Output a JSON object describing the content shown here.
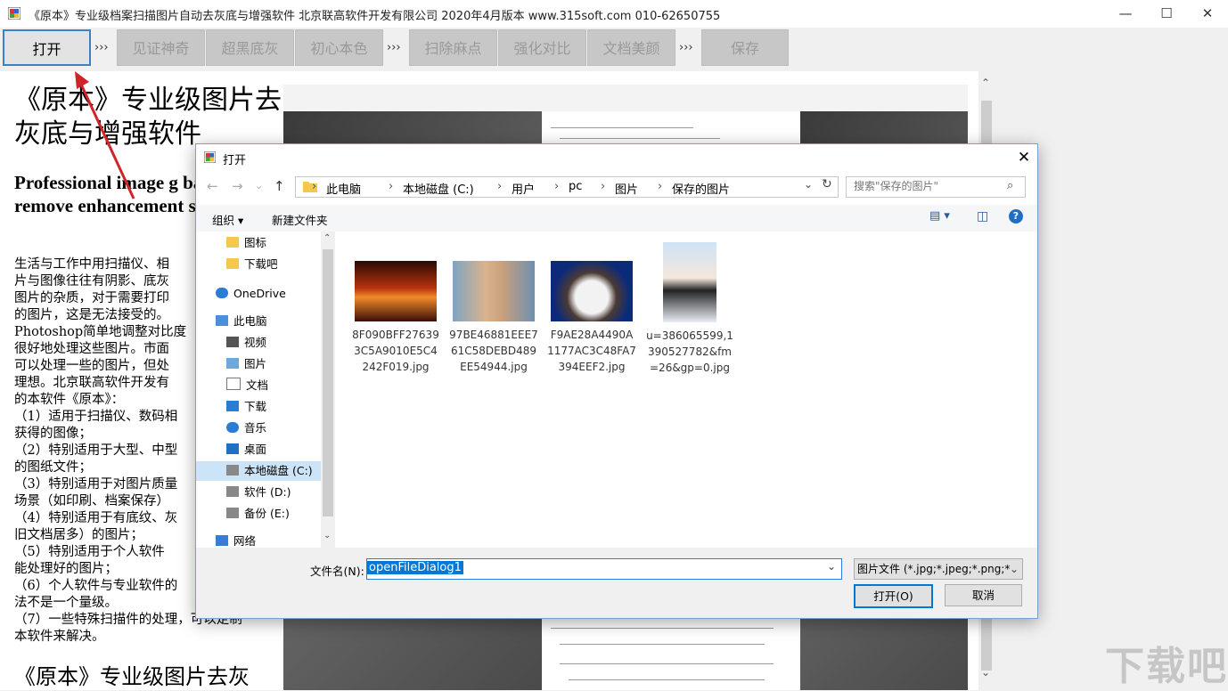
{
  "app": {
    "title": "《原本》专业级档案扫描图片自动去灰底与增强软件 北京联高软件开发有限公司 2020年4月版本 www.315soft.com 010-62650755",
    "icon": "app-window-icon"
  },
  "toolbar": {
    "open": "打开",
    "arrows": "›››",
    "miracle": "见证神奇",
    "superblack": "超黑底灰",
    "original_color": "初心本色",
    "remove_spots": "扫除麻点",
    "contrast": "强化对比",
    "beautify": "文档美颜",
    "save": "保存"
  },
  "doc": {
    "h1": "《原本》专业级图片去灰底与增强软件",
    "en": "Professional image g background remove enhancement softwa",
    "body": [
      "生活与工作中用扫描仪、相",
      "片与图像往往有阴影、底灰",
      "图片的杂质，对于需要打印",
      "的图片，这是无法接受的。",
      "Photoshop简单地调整对比度",
      "很好地处理这些图片。市面",
      "可以处理一些的图片，但处",
      "理想。北京联高软件开发有",
      "的本软件《原本》：",
      "（1）适用于扫描仪、数码相",
      "获得的图像；",
      "（2）特别适用于大型、中型",
      "的图纸文件；",
      "（3）特别适用于对图片质量",
      "场景（如印刷、档案保存）",
      "（4）特别适用于有底纹、灰",
      "旧文档居多）的图片；",
      "（5）特别适用于个人软件",
      "能处理好的图片；",
      "（6）个人软件与专业软件的",
      "法不是一个量级。",
      "（7）一些特殊扫描件的处理，可以定制",
      "本软件来解决。"
    ],
    "h2": "《原本》专业级图片去灰"
  },
  "dialog": {
    "title": "打开",
    "close": "✕",
    "back": "←",
    "forward": "→",
    "dropdown": "⌄",
    "up": "↑",
    "breadcrumb": [
      "此电脑",
      "本地磁盘 (C:)",
      "用户",
      "pc",
      "图片",
      "保存的图片"
    ],
    "crumb_sep": "›",
    "search_placeholder": "搜索\"保存的图片\"",
    "organize": "组织 ▾",
    "new_folder": "新建文件夹",
    "nav": [
      {
        "label": "图标",
        "icon": "folder-icon"
      },
      {
        "label": "下载吧",
        "icon": "folder-icon"
      },
      {
        "label": "OneDrive",
        "icon": "cloud-icon"
      },
      {
        "label": "此电脑",
        "icon": "computer-icon"
      },
      {
        "label": "视频",
        "icon": "video-icon"
      },
      {
        "label": "图片",
        "icon": "pictures-icon"
      },
      {
        "label": "文档",
        "icon": "document-icon"
      },
      {
        "label": "下载",
        "icon": "download-icon"
      },
      {
        "label": "音乐",
        "icon": "music-icon"
      },
      {
        "label": "桌面",
        "icon": "desktop-icon"
      },
      {
        "label": "本地磁盘 (C:)",
        "icon": "drive-icon"
      },
      {
        "label": "软件 (D:)",
        "icon": "drive-icon"
      },
      {
        "label": "备份 (E:)",
        "icon": "drive-icon"
      },
      {
        "label": "网络",
        "icon": "network-icon"
      }
    ],
    "files": [
      {
        "name": "8F090BFF276393C5A9010E5C4242F019.jpg",
        "thumb": "sunset-clouds"
      },
      {
        "name": "97BE46881EEE761C58DEBD489EE54944.jpg",
        "thumb": "anime-man"
      },
      {
        "name": "F9AE28A4490A1177AC3C48FA7394EEF2.jpg",
        "thumb": "ragdoll-cat"
      },
      {
        "name": "u=386065599,1390527782&fm=26&gp=0.jpg",
        "thumb": "magazine-girl"
      }
    ],
    "filename_label": "文件名(N):",
    "filename_value": "openFileDialog1",
    "filter": "图片文件 (*.jpg;*.jpeg;*.png;*.",
    "open_button": "打开(O)",
    "cancel_button": "取消"
  },
  "watermark": "下载吧"
}
